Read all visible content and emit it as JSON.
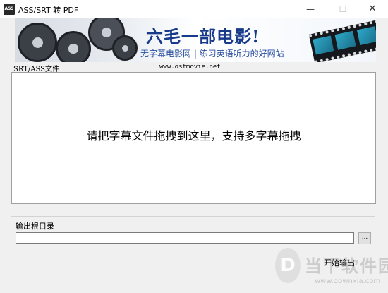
{
  "window": {
    "icon_text": "ASS",
    "title": "ASS/SRT 转 PDF",
    "minimize_glyph": "—",
    "maximize_glyph": "☐",
    "close_glyph": "✕"
  },
  "banner": {
    "title": "六毛一部电影!",
    "subtitle": "无字幕电影网 | 练习英语听力的好网站"
  },
  "file_section": {
    "label": "SRT/ASS文件",
    "site_url": "www.ostmovie.net",
    "drop_hint": "请把字幕文件拖拽到这里，支持多字幕拖拽"
  },
  "output": {
    "label": "输出根目录",
    "path_value": "",
    "browse_label": "...",
    "start_label": "开始输出"
  },
  "watermark": {
    "logo_glyph": "D",
    "name": "当下软件园",
    "url": "www.downxia.com"
  }
}
